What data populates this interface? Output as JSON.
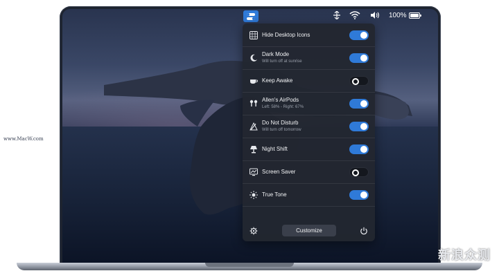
{
  "menubar": {
    "app_icon": "toggles-icon",
    "icons": [
      "airdrop-icon",
      "wifi-icon",
      "volume-icon"
    ],
    "battery_percent": "100%"
  },
  "panel": {
    "items": [
      {
        "title": "Hide Desktop Icons",
        "subtitle": "",
        "icon": "grid-icon",
        "enabled": true
      },
      {
        "title": "Dark Mode",
        "subtitle": "Will turn off at sunrise",
        "icon": "moon-icon",
        "enabled": true
      },
      {
        "title": "Keep Awake",
        "subtitle": "",
        "icon": "coffee-cup-icon",
        "enabled": false
      },
      {
        "title": "Allen's AirPods",
        "subtitle": "Left: 58% - Right: 67%",
        "icon": "airpods-icon",
        "enabled": true
      },
      {
        "title": "Do Not Disturb",
        "subtitle": "Will turn off tomorrow",
        "icon": "do-not-disturb-icon",
        "enabled": true
      },
      {
        "title": "Night Shift",
        "subtitle": "",
        "icon": "night-shift-lamp-icon",
        "enabled": true
      },
      {
        "title": "Screen Saver",
        "subtitle": "",
        "icon": "screen-saver-icon",
        "enabled": false
      },
      {
        "title": "True Tone",
        "subtitle": "",
        "icon": "sun-icon",
        "enabled": true
      }
    ],
    "footer": {
      "customize_label": "Customize"
    }
  },
  "watermarks": {
    "left": "www.MacW.com",
    "right": "新浪众测"
  },
  "colors": {
    "accent": "#2f7ad8",
    "panel_bg": "#222630"
  }
}
